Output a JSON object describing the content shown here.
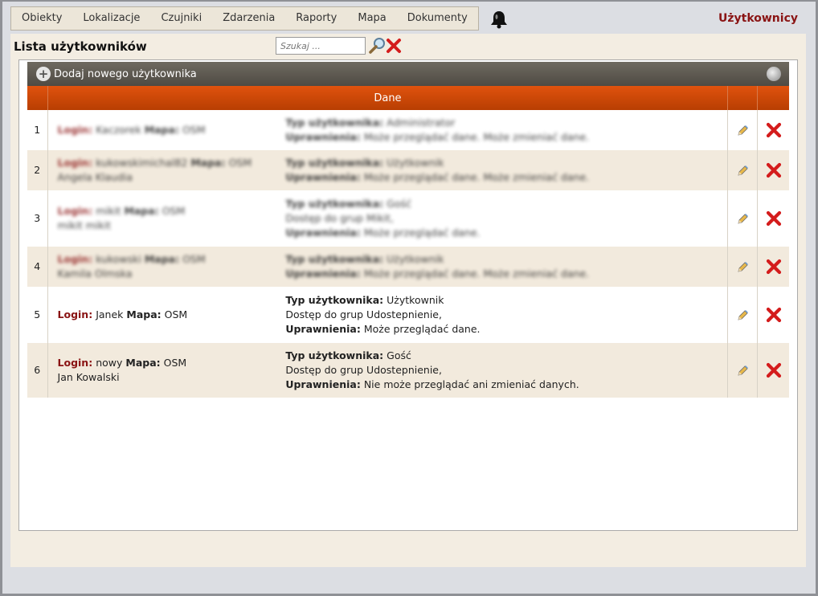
{
  "nav": {
    "items": [
      "Obiekty",
      "Lokalizacje",
      "Czujniki",
      "Zdarzenia",
      "Raporty",
      "Mapa",
      "Dokumenty"
    ],
    "active_section": "Użytkownicy"
  },
  "page": {
    "title": "Lista użytkowników",
    "search_placeholder": "Szukaj ..."
  },
  "toolbar": {
    "add_label": "Dodaj nowego użytkownika"
  },
  "table": {
    "header_data": "Dane",
    "labels": {
      "login": "Login:",
      "map": "Mapa:",
      "user_type": "Typ użytkownika:",
      "permissions": "Uprawnienia:"
    },
    "rows": [
      {
        "num": "1",
        "login": "Kaczorek",
        "map": "OSM",
        "name": "",
        "user_type": "Administrator",
        "groups": "",
        "permissions": "Może przeglądać dane. Może zmieniać dane."
      },
      {
        "num": "2",
        "login": "kukowskimichal82",
        "map": "OSM",
        "name": "Angela Klaudia",
        "user_type": "Użytkownik",
        "groups": "",
        "permissions": "Może przeglądać dane. Może zmieniać dane."
      },
      {
        "num": "3",
        "login": "mikit",
        "map": "OSM",
        "name": "mikit mikit",
        "user_type": "Gość",
        "groups": "Dostęp do grup Mikit,",
        "permissions": "Może przeglądać dane."
      },
      {
        "num": "4",
        "login": "kukowski",
        "map": "OSM",
        "name": "Kamila Olmska",
        "user_type": "Użytkownik",
        "groups": "",
        "permissions": "Może przeglądać dane. Może zmieniać dane."
      },
      {
        "num": "5",
        "login": "Janek",
        "map": "OSM",
        "name": "",
        "user_type": "Użytkownik",
        "groups": "Dostęp do grup Udostepnienie,",
        "permissions": "Może przeglądać dane."
      },
      {
        "num": "6",
        "login": "nowy",
        "map": "OSM",
        "name": "Jan Kowalski",
        "user_type": "Gość",
        "groups": "Dostęp do grup Udostepnienie,",
        "permissions": "Nie może przeglądać ani zmieniać danych."
      }
    ]
  },
  "colors": {
    "accent_red": "#8a1414",
    "header_orange": "#d04a08",
    "toolbar_dark": "#5a554d",
    "page_bg": "#f3ede2"
  }
}
